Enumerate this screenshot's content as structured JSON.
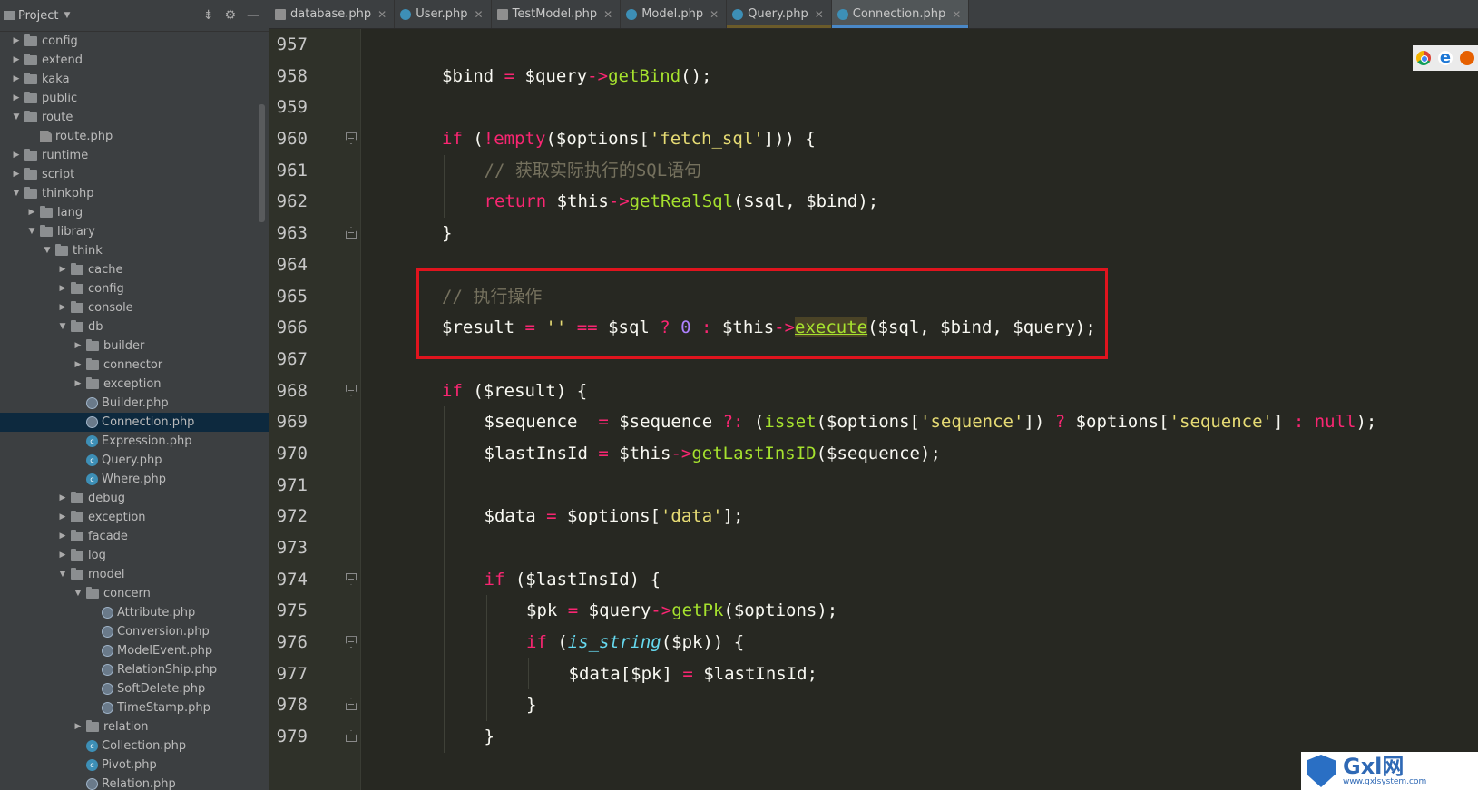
{
  "sidebar": {
    "title": "Project",
    "tree": [
      {
        "label": "config",
        "type": "folder",
        "depth": 0,
        "expanded": false
      },
      {
        "label": "extend",
        "type": "folder",
        "depth": 0,
        "expanded": false
      },
      {
        "label": "kaka",
        "type": "folder",
        "depth": 0,
        "expanded": false
      },
      {
        "label": "public",
        "type": "folder",
        "depth": 0,
        "expanded": false
      },
      {
        "label": "route",
        "type": "folder",
        "depth": 0,
        "expanded": true
      },
      {
        "label": "route.php",
        "type": "phpfile",
        "depth": 1
      },
      {
        "label": "runtime",
        "type": "folder",
        "depth": 0,
        "expanded": false
      },
      {
        "label": "script",
        "type": "folder",
        "depth": 0,
        "expanded": false
      },
      {
        "label": "thinkphp",
        "type": "folder",
        "depth": 0,
        "expanded": true
      },
      {
        "label": "lang",
        "type": "folder",
        "depth": 1,
        "expanded": false
      },
      {
        "label": "library",
        "type": "folder",
        "depth": 1,
        "expanded": true
      },
      {
        "label": "think",
        "type": "folder",
        "depth": 2,
        "expanded": true
      },
      {
        "label": "cache",
        "type": "folder",
        "depth": 3,
        "expanded": false
      },
      {
        "label": "config",
        "type": "folder",
        "depth": 3,
        "expanded": false
      },
      {
        "label": "console",
        "type": "folder",
        "depth": 3,
        "expanded": false
      },
      {
        "label": "db",
        "type": "folder",
        "depth": 3,
        "expanded": true
      },
      {
        "label": "builder",
        "type": "folder",
        "depth": 4,
        "expanded": false
      },
      {
        "label": "connector",
        "type": "folder",
        "depth": 4,
        "expanded": false
      },
      {
        "label": "exception",
        "type": "folder",
        "depth": 4,
        "expanded": false
      },
      {
        "label": "Builder.php",
        "type": "abstract",
        "depth": 4
      },
      {
        "label": "Connection.php",
        "type": "abstract",
        "depth": 4,
        "selected": true
      },
      {
        "label": "Expression.php",
        "type": "class",
        "depth": 4
      },
      {
        "label": "Query.php",
        "type": "class",
        "depth": 4
      },
      {
        "label": "Where.php",
        "type": "class",
        "depth": 4
      },
      {
        "label": "debug",
        "type": "folder",
        "depth": 3,
        "expanded": false
      },
      {
        "label": "exception",
        "type": "folder",
        "depth": 3,
        "expanded": false
      },
      {
        "label": "facade",
        "type": "folder",
        "depth": 3,
        "expanded": false
      },
      {
        "label": "log",
        "type": "folder",
        "depth": 3,
        "expanded": false
      },
      {
        "label": "model",
        "type": "folder",
        "depth": 3,
        "expanded": true
      },
      {
        "label": "concern",
        "type": "folder",
        "depth": 4,
        "expanded": true
      },
      {
        "label": "Attribute.php",
        "type": "abstract",
        "depth": 5
      },
      {
        "label": "Conversion.php",
        "type": "abstract",
        "depth": 5
      },
      {
        "label": "ModelEvent.php",
        "type": "abstract",
        "depth": 5
      },
      {
        "label": "RelationShip.php",
        "type": "abstract",
        "depth": 5
      },
      {
        "label": "SoftDelete.php",
        "type": "abstract",
        "depth": 5
      },
      {
        "label": "TimeStamp.php",
        "type": "abstract",
        "depth": 5
      },
      {
        "label": "relation",
        "type": "folder",
        "depth": 4,
        "expanded": false
      },
      {
        "label": "Collection.php",
        "type": "class",
        "depth": 4
      },
      {
        "label": "Pivot.php",
        "type": "class",
        "depth": 4
      },
      {
        "label": "Relation.php",
        "type": "abstract",
        "depth": 4
      }
    ]
  },
  "tabs": [
    {
      "label": "database.php",
      "icon": "php",
      "active": false
    },
    {
      "label": "User.php",
      "icon": "c",
      "active": false
    },
    {
      "label": "TestModel.php",
      "icon": "php",
      "active": false
    },
    {
      "label": "Model.php",
      "icon": "c",
      "active": false
    },
    {
      "label": "Query.php",
      "icon": "c",
      "active": false
    },
    {
      "label": "Connection.php",
      "icon": "c",
      "active": true
    }
  ],
  "editor": {
    "lines": [
      {
        "n": "957",
        "indent": 0,
        "fold": "",
        "tokens": []
      },
      {
        "n": "958",
        "indent": 0,
        "fold": "",
        "tokens": [
          [
            "v",
            "$bind "
          ],
          [
            "k",
            "= "
          ],
          [
            "v",
            "$query"
          ],
          [
            "k",
            "->"
          ],
          [
            "f",
            "getBind"
          ],
          [
            "v",
            "();"
          ]
        ]
      },
      {
        "n": "959",
        "indent": 0,
        "fold": "",
        "tokens": []
      },
      {
        "n": "960",
        "indent": 0,
        "fold": "open",
        "tokens": [
          [
            "k",
            "if "
          ],
          [
            "v",
            "("
          ],
          [
            "k",
            "!"
          ],
          [
            "k",
            "empty"
          ],
          [
            "v",
            "($options["
          ],
          [
            "s",
            "'fetch_sql'"
          ],
          [
            "v",
            "])) {"
          ]
        ]
      },
      {
        "n": "961",
        "indent": 1,
        "fold": "",
        "tokens": [
          [
            "c",
            "// 获取实际执行的SQL语句"
          ]
        ]
      },
      {
        "n": "962",
        "indent": 1,
        "fold": "",
        "tokens": [
          [
            "k",
            "return "
          ],
          [
            "v",
            "$this"
          ],
          [
            "k",
            "->"
          ],
          [
            "f",
            "getRealSql"
          ],
          [
            "v",
            "($sql, $bind);"
          ]
        ]
      },
      {
        "n": "963",
        "indent": 0,
        "fold": "close",
        "tokens": [
          [
            "v",
            "}"
          ]
        ]
      },
      {
        "n": "964",
        "indent": 0,
        "fold": "",
        "tokens": []
      },
      {
        "n": "965",
        "indent": 0,
        "fold": "",
        "tokens": [
          [
            "c",
            "// 执行操作"
          ]
        ]
      },
      {
        "n": "966",
        "indent": 0,
        "fold": "",
        "tokens": [
          [
            "v",
            "$result "
          ],
          [
            "k",
            "= "
          ],
          [
            "s",
            "'' "
          ],
          [
            "k",
            "== "
          ],
          [
            "v",
            "$sql "
          ],
          [
            "k",
            "? "
          ],
          [
            "n",
            "0 "
          ],
          [
            "k",
            ": "
          ],
          [
            "v",
            "$this"
          ],
          [
            "k",
            "->"
          ],
          [
            "f hl",
            "execute"
          ],
          [
            "v",
            "($sql, $bind, $query);"
          ]
        ]
      },
      {
        "n": "967",
        "indent": 0,
        "fold": "",
        "tokens": []
      },
      {
        "n": "968",
        "indent": 0,
        "fold": "open",
        "tokens": [
          [
            "k",
            "if "
          ],
          [
            "v",
            "($result) {"
          ]
        ]
      },
      {
        "n": "969",
        "indent": 1,
        "fold": "",
        "tokens": [
          [
            "v",
            "$sequence  "
          ],
          [
            "k",
            "= "
          ],
          [
            "v",
            "$sequence "
          ],
          [
            "k",
            "?: "
          ],
          [
            "v",
            "("
          ],
          [
            "f",
            "isset"
          ],
          [
            "v",
            "($options["
          ],
          [
            "s",
            "'sequence'"
          ],
          [
            "v",
            "]) "
          ],
          [
            "k",
            "? "
          ],
          [
            "v",
            "$options["
          ],
          [
            "s",
            "'sequence'"
          ],
          [
            "v",
            "] "
          ],
          [
            "k",
            ": null"
          ],
          [
            "v",
            ");"
          ]
        ]
      },
      {
        "n": "970",
        "indent": 1,
        "fold": "",
        "tokens": [
          [
            "v",
            "$lastInsId "
          ],
          [
            "k",
            "= "
          ],
          [
            "v",
            "$this"
          ],
          [
            "k",
            "->"
          ],
          [
            "f",
            "getLastInsID"
          ],
          [
            "v",
            "($sequence);"
          ]
        ]
      },
      {
        "n": "971",
        "indent": 1,
        "fold": "",
        "tokens": []
      },
      {
        "n": "972",
        "indent": 1,
        "fold": "",
        "tokens": [
          [
            "v",
            "$data "
          ],
          [
            "k",
            "= "
          ],
          [
            "v",
            "$options["
          ],
          [
            "s",
            "'data'"
          ],
          [
            "v",
            "];"
          ]
        ]
      },
      {
        "n": "973",
        "indent": 1,
        "fold": "",
        "tokens": []
      },
      {
        "n": "974",
        "indent": 1,
        "fold": "open",
        "tokens": [
          [
            "k",
            "if "
          ],
          [
            "v",
            "($lastInsId) {"
          ]
        ]
      },
      {
        "n": "975",
        "indent": 2,
        "fold": "",
        "tokens": [
          [
            "v",
            "$pk "
          ],
          [
            "k",
            "= "
          ],
          [
            "v",
            "$query"
          ],
          [
            "k",
            "->"
          ],
          [
            "f",
            "getPk"
          ],
          [
            "v",
            "($options);"
          ]
        ]
      },
      {
        "n": "976",
        "indent": 2,
        "fold": "open",
        "tokens": [
          [
            "k",
            "if "
          ],
          [
            "v",
            "("
          ],
          [
            "i",
            "is_string"
          ],
          [
            "v",
            "($pk)) {"
          ]
        ]
      },
      {
        "n": "977",
        "indent": 3,
        "fold": "",
        "tokens": [
          [
            "v",
            "$data[$pk] "
          ],
          [
            "k",
            "= "
          ],
          [
            "v",
            "$lastInsId;"
          ]
        ]
      },
      {
        "n": "978",
        "indent": 2,
        "fold": "close",
        "tokens": [
          [
            "v",
            "}"
          ]
        ]
      },
      {
        "n": "979",
        "indent": 1,
        "fold": "close",
        "tokens": [
          [
            "v",
            "}"
          ]
        ]
      }
    ]
  },
  "watermark": {
    "brand": "Gxl网",
    "url": "www.gxlsystem.com"
  }
}
